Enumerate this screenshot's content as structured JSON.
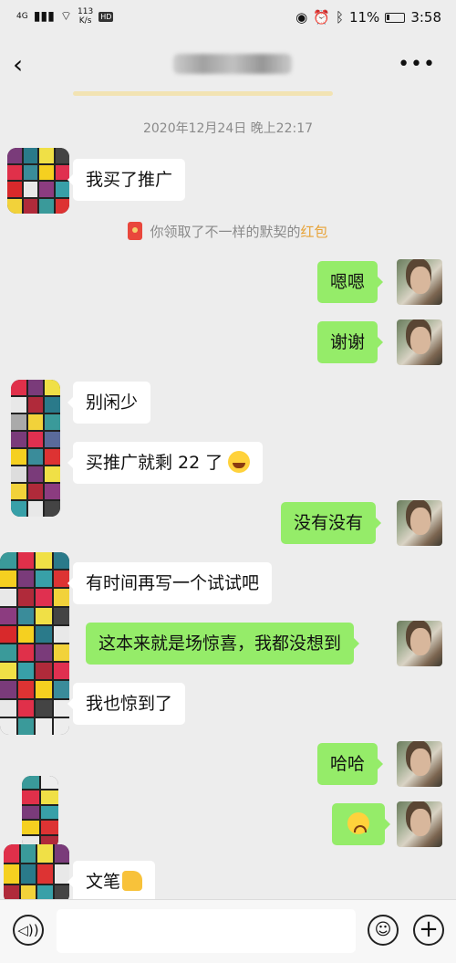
{
  "status": {
    "network": "4G",
    "speed_value": "113",
    "speed_unit": "K/s",
    "hd": "HD",
    "battery": "11%",
    "time": "3:58"
  },
  "nav": {
    "back_icon": "chevron-left-icon",
    "more_icon": "more-icon",
    "more_label": "•••"
  },
  "chat": {
    "timestamp": "2020年12月24日 晚上22:17",
    "system_notice": {
      "prefix": "你领取了不一样的默契的",
      "highlight": "红包"
    },
    "messages": [
      {
        "side": "left",
        "text": "我买了推广"
      },
      {
        "side": "right",
        "text": "嗯嗯"
      },
      {
        "side": "right",
        "text": "谢谢"
      },
      {
        "side": "left",
        "text": "别闲少"
      },
      {
        "side": "left",
        "text": "买推广就剩 22 了"
      },
      {
        "side": "right",
        "text": "没有没有"
      },
      {
        "side": "left",
        "text": "有时间再写一个试试吧"
      },
      {
        "side": "right",
        "text": "这本来就是场惊喜，我都没想到"
      },
      {
        "side": "left",
        "text": "我也惊到了"
      },
      {
        "side": "right",
        "text": "哈哈"
      },
      {
        "side": "right",
        "text": ""
      },
      {
        "side": "left",
        "text": "文笔"
      }
    ]
  },
  "input": {
    "voice_label": "◁))",
    "emoji_label": "☺",
    "plus_label": "+"
  },
  "colors": {
    "background": "#ededed",
    "right_bubble": "#95ec69",
    "left_bubble": "#ffffff",
    "highlight": "#e7a236"
  }
}
